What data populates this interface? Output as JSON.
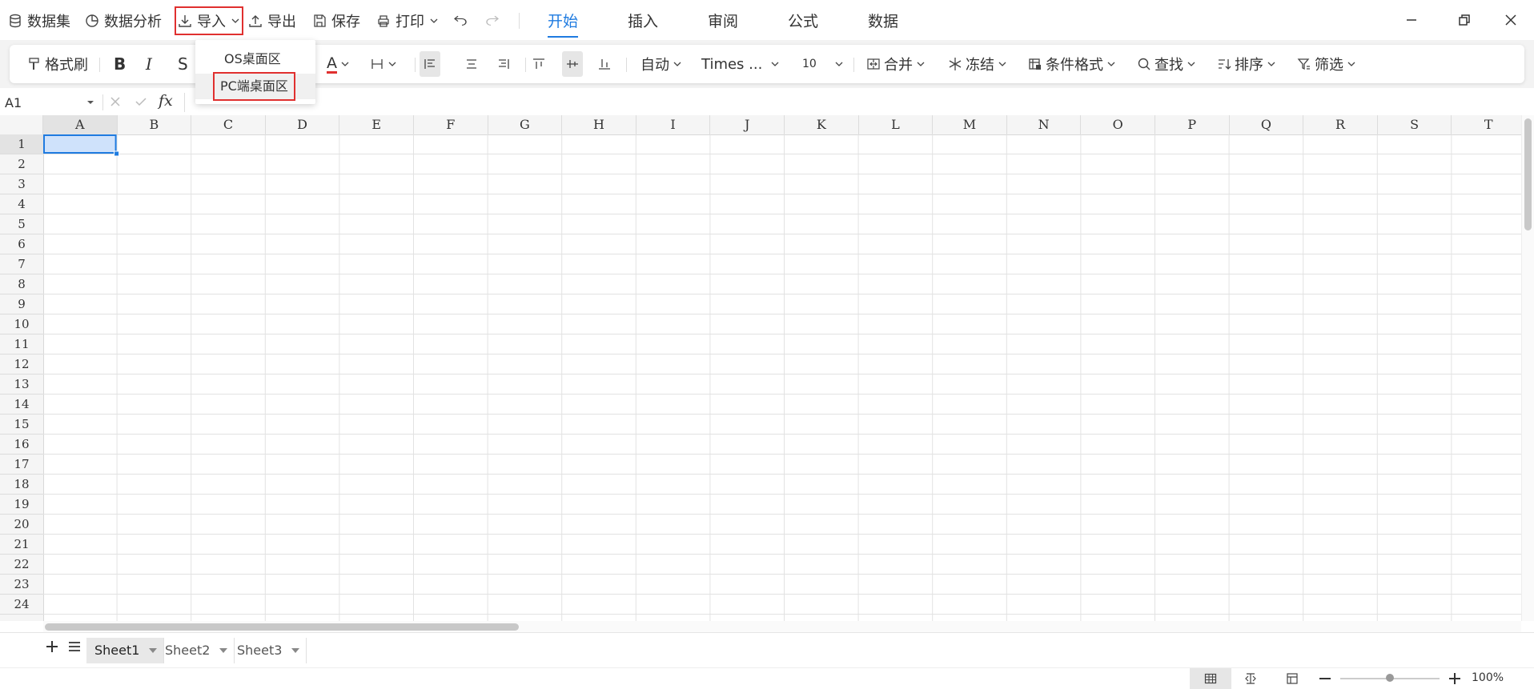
{
  "topbar": {
    "dataset": "数据集",
    "analysis": "数据分析",
    "import": "导入",
    "export": "导出",
    "save": "保存",
    "print": "打印",
    "tabs": [
      "开始",
      "插入",
      "审阅",
      "公式",
      "数据"
    ],
    "active_tab": "开始"
  },
  "import_menu": {
    "items": [
      "OS桌面区",
      "PC端桌面区"
    ],
    "highlighted": "PC端桌面区"
  },
  "ribbon": {
    "format_painter": "格式刷",
    "bold": "B",
    "italic": "I",
    "strike": "S",
    "font_color": "A",
    "wrap": "自动",
    "font_name": "Times ...",
    "font_size": "10",
    "merge": "合并",
    "freeze": "冻结",
    "cond_format": "条件格式",
    "find": "查找",
    "sort": "排序",
    "filter": "筛选"
  },
  "formula_bar": {
    "cell_ref": "A1",
    "fx": "fx"
  },
  "grid": {
    "columns": [
      "A",
      "B",
      "C",
      "D",
      "E",
      "F",
      "G",
      "H",
      "I",
      "J",
      "K",
      "L",
      "M",
      "N",
      "O",
      "P",
      "Q",
      "R",
      "S",
      "T"
    ],
    "rows": [
      "1",
      "2",
      "3",
      "4",
      "5",
      "6",
      "7",
      "8",
      "9",
      "10",
      "11",
      "12",
      "13",
      "14",
      "15",
      "16",
      "17",
      "18",
      "19",
      "20",
      "21",
      "22",
      "23",
      "24"
    ],
    "selected_cell": "A1"
  },
  "sheets": {
    "tabs": [
      "Sheet1",
      "Sheet2",
      "Sheet3"
    ],
    "active": "Sheet1"
  },
  "status": {
    "zoom": "100%",
    "zoom_level": 0.5
  },
  "colors": {
    "accent": "#1f7be0",
    "highlight_box": "#e0302f",
    "selection_fill": "#cfe2fb"
  }
}
